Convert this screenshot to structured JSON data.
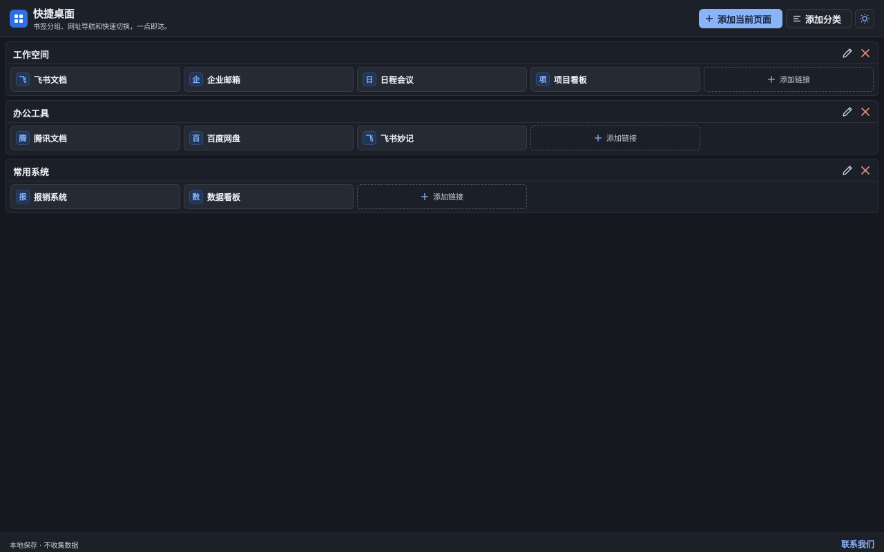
{
  "app": {
    "title": "快捷桌面",
    "subtitle": "书签分组、网址导航和快速切换，一点即达。",
    "logo_icon": "grid-icon"
  },
  "toolbar": {
    "add_page_label": "添加当前页面",
    "add_category_label": "添加分类",
    "theme_icon": "sun-icon"
  },
  "colors": {
    "accent": "#8ab4f8",
    "danger": "#f28b82",
    "background": "#15181f"
  },
  "sections": [
    {
      "title": "工作空间",
      "links": [
        {
          "badge": "飞",
          "label": "飞书文档"
        },
        {
          "badge": "企",
          "label": "企业邮箱"
        },
        {
          "badge": "日",
          "label": "日程会议"
        },
        {
          "badge": "项",
          "label": "项目看板"
        }
      ],
      "add_label": "添加链接"
    },
    {
      "title": "办公工具",
      "links": [
        {
          "badge": "腾",
          "label": "腾讯文档"
        },
        {
          "badge": "百",
          "label": "百度网盘"
        },
        {
          "badge": "飞",
          "label": "飞书妙记"
        }
      ],
      "add_label": "添加链接"
    },
    {
      "title": "常用系统",
      "links": [
        {
          "badge": "报",
          "label": "报销系统"
        },
        {
          "badge": "数",
          "label": "数据看板"
        }
      ],
      "add_label": "添加链接"
    }
  ],
  "footer": {
    "note": "本地保存 · 不收集数据",
    "contact_label": "联系我们"
  }
}
